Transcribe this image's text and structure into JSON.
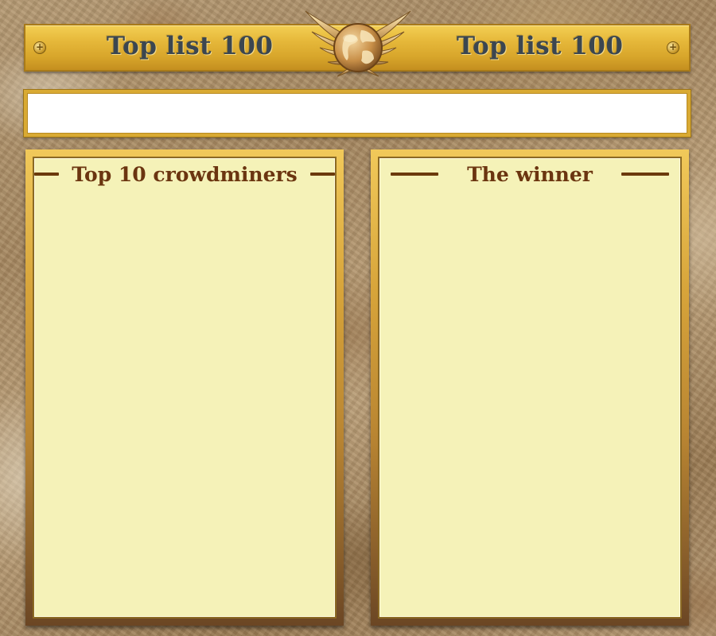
{
  "header": {
    "title_left": "Top list 100",
    "title_right": "Top list 100",
    "emblem": "winged-globe-icon",
    "left_rivet_icon": "plus-icon",
    "right_rivet_icon": "plus-icon",
    "rivet_glyph": "+"
  },
  "message_bar": {
    "text": ""
  },
  "panels": {
    "top10": {
      "title": "Top 10 crowdminers",
      "items": []
    },
    "winner": {
      "title": "The winner",
      "name": ""
    }
  },
  "colors": {
    "gold": "#e6b83a",
    "parchment": "#f5f2b8",
    "title_brown": "#6b3510",
    "header_text": "#3b4650"
  }
}
